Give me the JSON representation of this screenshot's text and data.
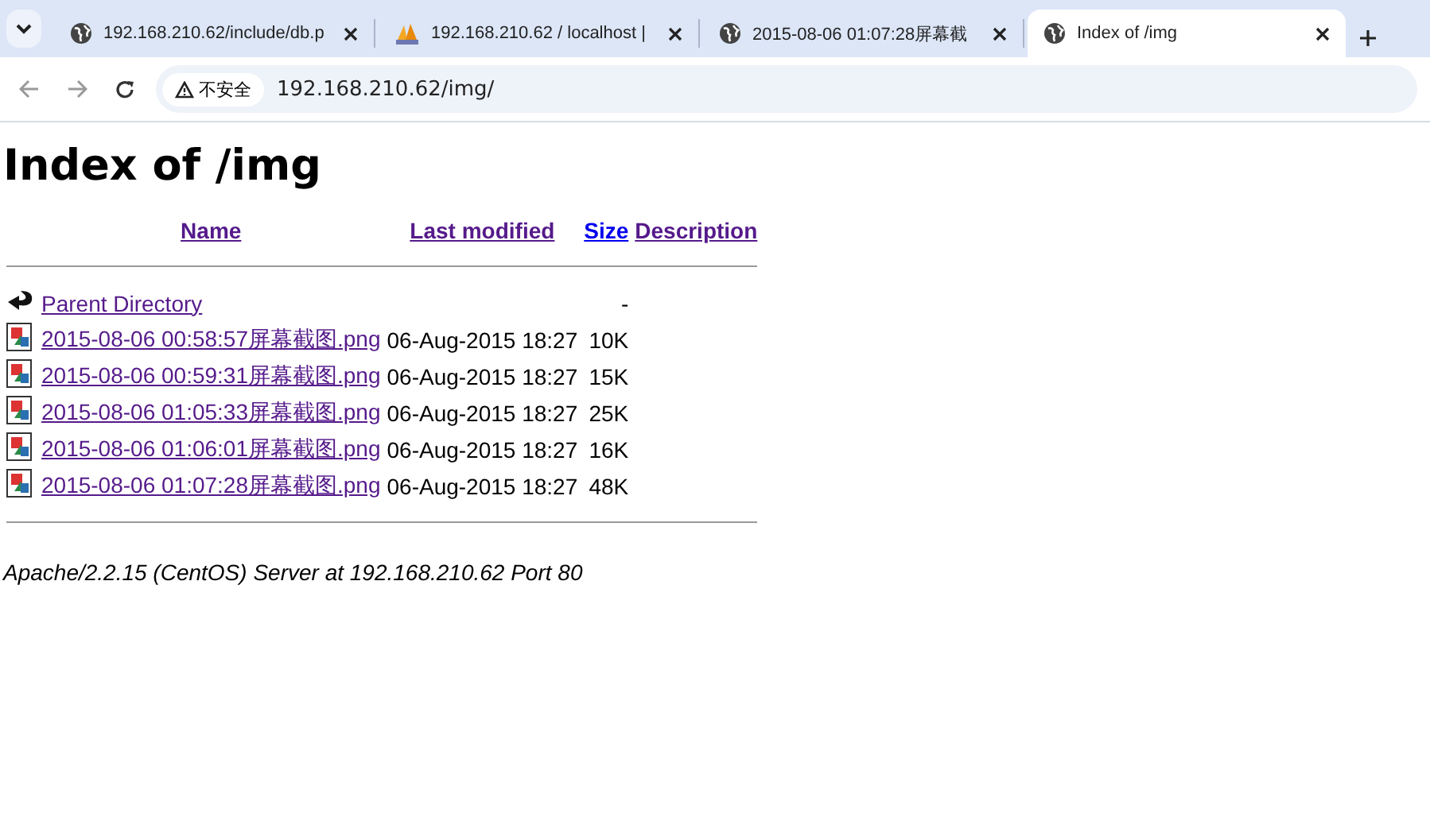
{
  "browser": {
    "tabs": [
      {
        "title": "192.168.210.62/include/db.p",
        "kind": "globe",
        "selected": false
      },
      {
        "title": "192.168.210.62 / localhost |",
        "kind": "sail",
        "selected": false
      },
      {
        "title": "2015-08-06 01:07:28屏幕截",
        "kind": "globe",
        "selected": false
      },
      {
        "title": "Index of /img",
        "kind": "globe",
        "selected": true
      }
    ],
    "security_label": "不安全",
    "url": "192.168.210.62/img/"
  },
  "page": {
    "heading": "Index of /img",
    "columns": [
      {
        "label": "Name",
        "visited": true
      },
      {
        "label": "Last modified",
        "visited": true
      },
      {
        "label": "Size",
        "visited": false
      },
      {
        "label": "Description",
        "visited": true
      }
    ],
    "rows": [
      {
        "kind": "parent",
        "name": "Parent Directory",
        "size": "-"
      },
      {
        "kind": "file",
        "name": "2015-08-06 00:58:57屏幕截图.png",
        "modified": "06-Aug-2015 18:27",
        "size": "10K"
      },
      {
        "kind": "file",
        "name": "2015-08-06 00:59:31屏幕截图.png",
        "modified": "06-Aug-2015 18:27",
        "size": "15K"
      },
      {
        "kind": "file",
        "name": "2015-08-06 01:05:33屏幕截图.png",
        "modified": "06-Aug-2015 18:27",
        "size": "25K"
      },
      {
        "kind": "file",
        "name": "2015-08-06 01:06:01屏幕截图.png",
        "modified": "06-Aug-2015 18:27",
        "size": "16K"
      },
      {
        "kind": "file",
        "name": "2015-08-06 01:07:28屏幕截图.png",
        "modified": "06-Aug-2015 18:27",
        "size": "48K"
      }
    ],
    "footer": "Apache/2.2.15 (CentOS) Server at 192.168.210.62 Port 80"
  }
}
